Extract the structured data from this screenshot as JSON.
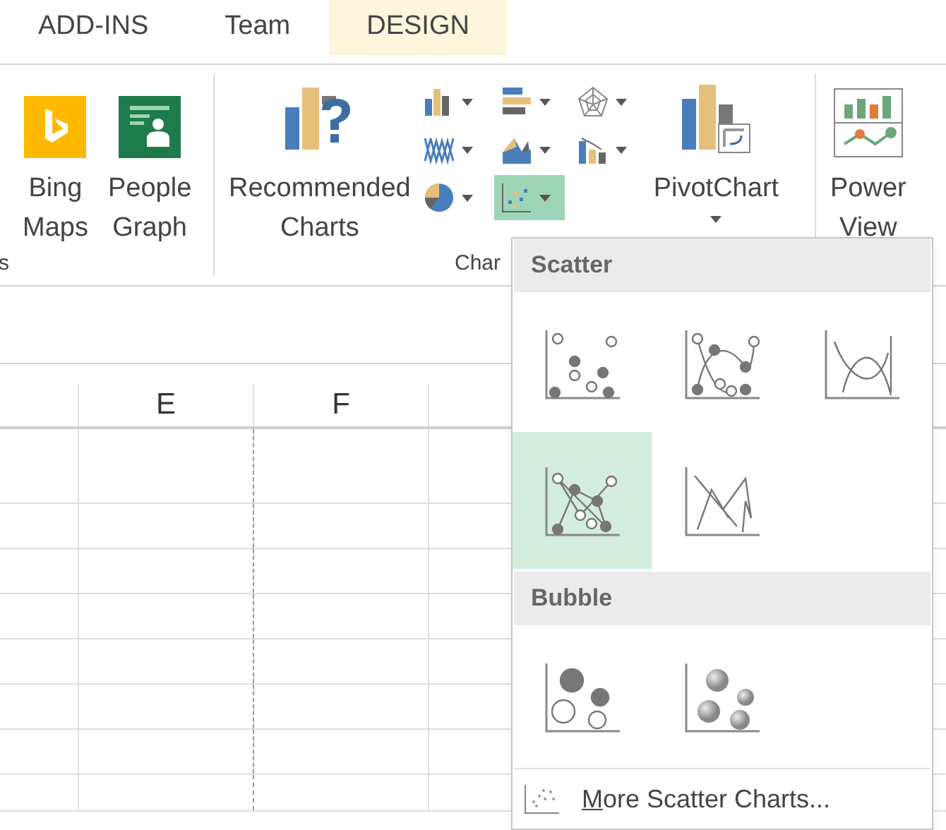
{
  "tabs": [
    {
      "label": "ADD-INS",
      "selected": false
    },
    {
      "label": "Team",
      "selected": false
    },
    {
      "label": "DESIGN",
      "selected": true
    }
  ],
  "ribbon": {
    "buttons": [
      {
        "kind": "bing",
        "lines": [
          "Bing",
          "Maps"
        ]
      },
      {
        "kind": "people",
        "lines": [
          "People",
          "Graph"
        ]
      },
      {
        "kind": "recommended",
        "lines": [
          "Recommended",
          "Charts"
        ]
      }
    ],
    "chart_types": [
      {
        "kind": "column",
        "selected": false
      },
      {
        "kind": "bar",
        "selected": false
      },
      {
        "kind": "radar",
        "selected": false
      },
      {
        "kind": "line",
        "selected": false
      },
      {
        "kind": "area",
        "selected": false
      },
      {
        "kind": "combo",
        "selected": false
      },
      {
        "kind": "pie",
        "selected": false
      },
      {
        "kind": "scatter",
        "selected": true
      }
    ],
    "buttons_right": [
      {
        "kind": "pivot",
        "lines": [
          "PivotChart"
        ],
        "has_caret": true
      },
      {
        "kind": "power",
        "lines": [
          "Power",
          "View"
        ]
      }
    ],
    "group_labels": [
      "s",
      "Char"
    ]
  },
  "columns": [
    "E",
    "F"
  ],
  "menu": {
    "sections": [
      {
        "title": "Scatter",
        "items": [
          {
            "kind": "markers",
            "selected": false
          },
          {
            "kind": "smooth-markers",
            "selected": false
          },
          {
            "kind": "smooth",
            "selected": false
          },
          {
            "kind": "straight-markers",
            "selected": true
          },
          {
            "kind": "straight",
            "selected": false
          }
        ]
      },
      {
        "title": "Bubble",
        "items": [
          {
            "kind": "bubble",
            "selected": false
          },
          {
            "kind": "bubble-3d",
            "selected": false
          }
        ]
      }
    ],
    "more": {
      "label": "More Scatter Charts...",
      "access_key_underlined": true
    }
  }
}
